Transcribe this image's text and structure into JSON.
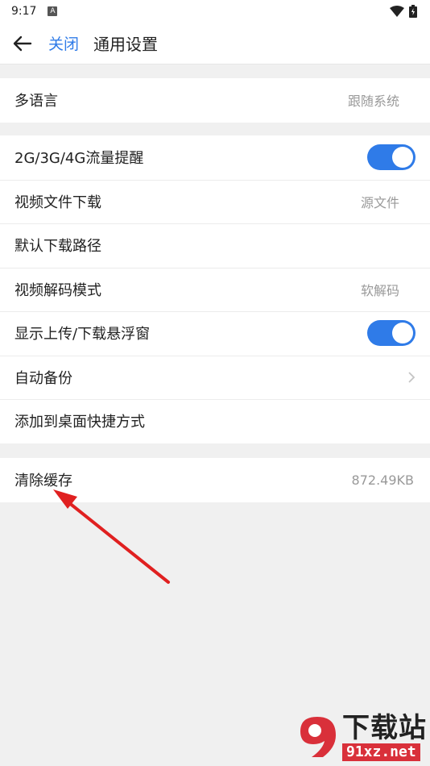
{
  "status_bar": {
    "time": "9:17",
    "a_icon_label": "A"
  },
  "header": {
    "close_label": "关闭",
    "title": "通用设置"
  },
  "groups": [
    {
      "rows": [
        {
          "label": "多语言",
          "value": "跟随系统"
        }
      ]
    },
    {
      "rows": [
        {
          "label": "2G/3G/4G流量提醒",
          "toggle": true
        },
        {
          "label": "视频文件下载",
          "value": "源文件"
        },
        {
          "label": "默认下载路径"
        },
        {
          "label": "视频解码模式",
          "value": "软解码"
        },
        {
          "label": "显示上传/下载悬浮窗",
          "toggle": true
        },
        {
          "label": "自动备份",
          "chevron": true
        },
        {
          "label": "添加到桌面快捷方式"
        }
      ]
    },
    {
      "rows": [
        {
          "label": "清除缓存",
          "value": "872.49KB"
        }
      ]
    }
  ],
  "colors": {
    "accent": "#2f7be8",
    "annotation_arrow": "#e02020",
    "watermark_red": "#d9303a"
  },
  "watermark": {
    "title": "下载站",
    "url": "91xz.net",
    "badge": "91"
  }
}
